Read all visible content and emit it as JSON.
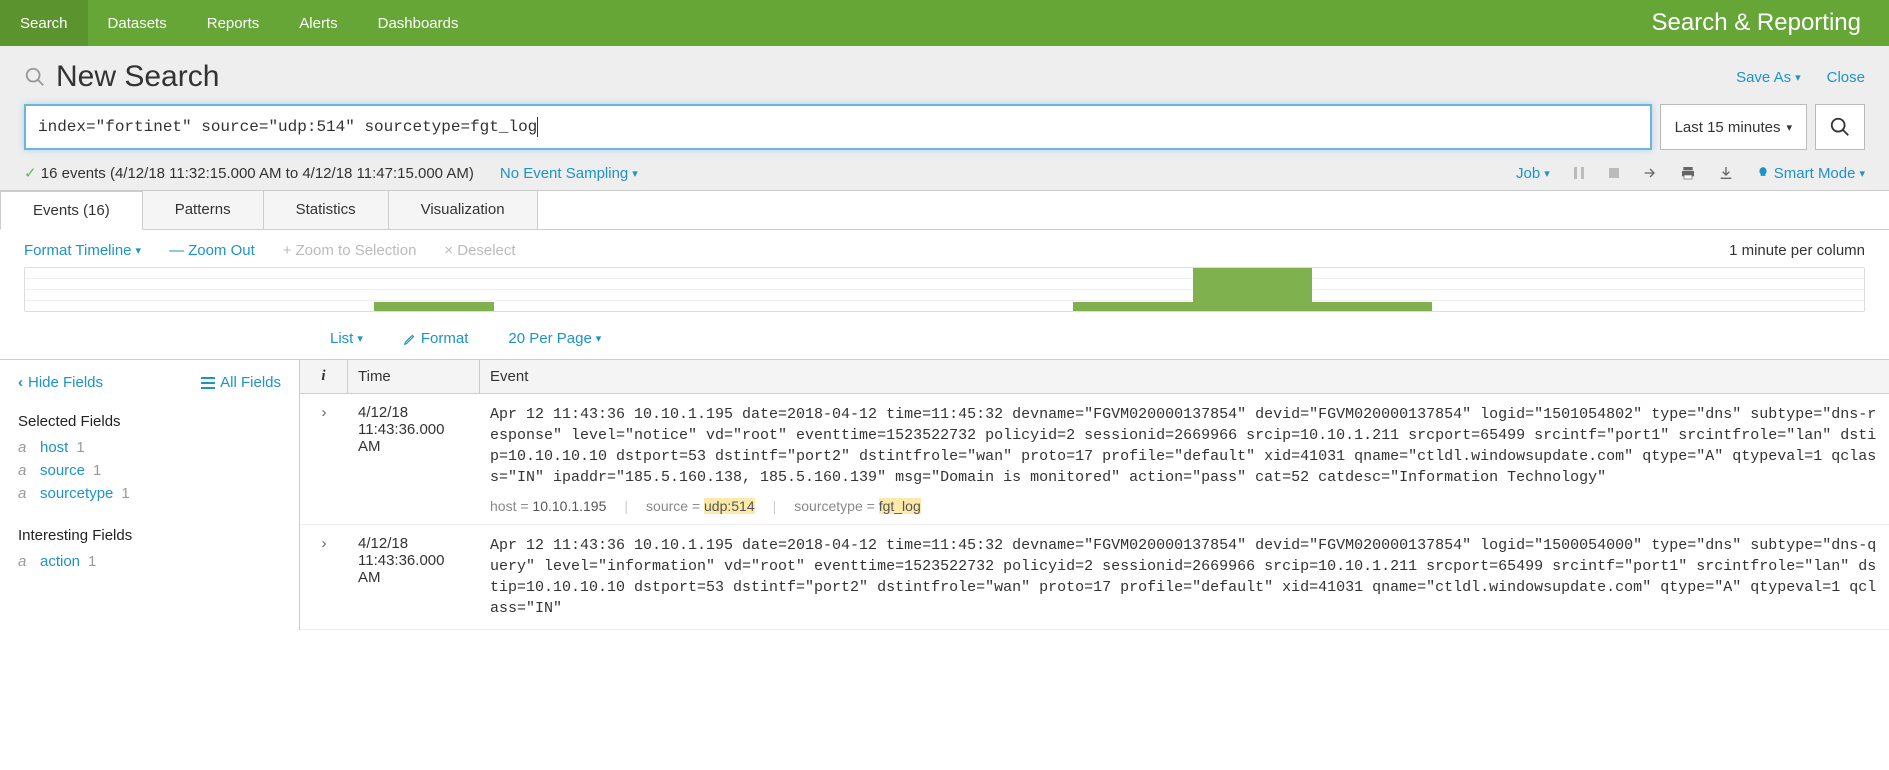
{
  "topnav": {
    "items": [
      "Search",
      "Datasets",
      "Reports",
      "Alerts",
      "Dashboards"
    ],
    "active_index": 0,
    "app_title": "Search & Reporting"
  },
  "header": {
    "title": "New Search",
    "save_as": "Save As",
    "close": "Close"
  },
  "search": {
    "query": "index=\"fortinet\" source=\"udp:514\" sourcetype=fgt_log",
    "time_range": "Last 15 minutes"
  },
  "status": {
    "summary": "16 events (4/12/18 11:32:15.000 AM to 4/12/18 11:47:15.000 AM)",
    "sampling_label": "No Event Sampling",
    "job_label": "Job",
    "mode_label": "Smart Mode"
  },
  "tabs": {
    "events": "Events (16)",
    "patterns": "Patterns",
    "statistics": "Statistics",
    "visualization": "Visualization"
  },
  "timeline_bar": {
    "format": "Format Timeline",
    "zoom_out": "Zoom Out",
    "zoom_sel": "Zoom to Selection",
    "deselect": "Deselect",
    "scale": "1 minute per column"
  },
  "results_controls": {
    "list": "List",
    "format": "Format",
    "per_page": "20 Per Page"
  },
  "sidebar": {
    "hide_fields": "Hide Fields",
    "all_fields": "All Fields",
    "selected_title": "Selected Fields",
    "interesting_title": "Interesting Fields",
    "selected": [
      {
        "type": "a",
        "name": "host",
        "count": "1"
      },
      {
        "type": "a",
        "name": "source",
        "count": "1"
      },
      {
        "type": "a",
        "name": "sourcetype",
        "count": "1"
      }
    ],
    "interesting": [
      {
        "type": "a",
        "name": "action",
        "count": "1"
      }
    ]
  },
  "events_table": {
    "col_i": "i",
    "col_time": "Time",
    "col_event": "Event"
  },
  "events": [
    {
      "time_date": "4/12/18",
      "time_full": "11:43:36.000 AM",
      "raw": "Apr 12 11:43:36 10.10.1.195 date=2018-04-12 time=11:45:32 devname=\"FGVM020000137854\" devid=\"FGVM020000137854\" logid=\"1501054802\" type=\"dns\" subtype=\"dns-response\" level=\"notice\" vd=\"root\" eventtime=1523522732 policyid=2 sessionid=2669966 srcip=10.10.1.211 srcport=65499 srcintf=\"port1\" srcintfrole=\"lan\" dstip=10.10.10.10 dstport=53 dstintf=\"port2\" dstintfrole=\"wan\" proto=17 profile=\"default\" xid=41031 qname=\"ctldl.windowsupdate.com\" qtype=\"A\" qtypeval=1 qclass=\"IN\" ipaddr=\"185.5.160.138, 185.5.160.139\" msg=\"Domain is monitored\" action=\"pass\" cat=52 catdesc=\"Information Technology\"",
      "meta_host_key": "host = ",
      "meta_host_val": "10.10.1.195",
      "meta_source_key": "source = ",
      "meta_source_val": "udp:514",
      "meta_st_key": "sourcetype = ",
      "meta_st_val": "fgt_log"
    },
    {
      "time_date": "4/12/18",
      "time_full": "11:43:36.000 AM",
      "raw": "Apr 12 11:43:36 10.10.1.195 date=2018-04-12 time=11:45:32 devname=\"FGVM020000137854\" devid=\"FGVM020000137854\" logid=\"1500054000\" type=\"dns\" subtype=\"dns-query\" level=\"information\" vd=\"root\" eventtime=1523522732 policyid=2 sessionid=2669966 srcip=10.10.1.211 srcport=65499 srcintf=\"port1\" srcintfrole=\"lan\" dstip=10.10.10.10 dstport=53 dstintf=\"port2\" dstintfrole=\"wan\" proto=17 profile=\"default\" xid=41031 qname=\"ctldl.windowsupdate.com\" qtype=\"A\" qtypeval=1 qclass=\"IN\""
    }
  ]
}
